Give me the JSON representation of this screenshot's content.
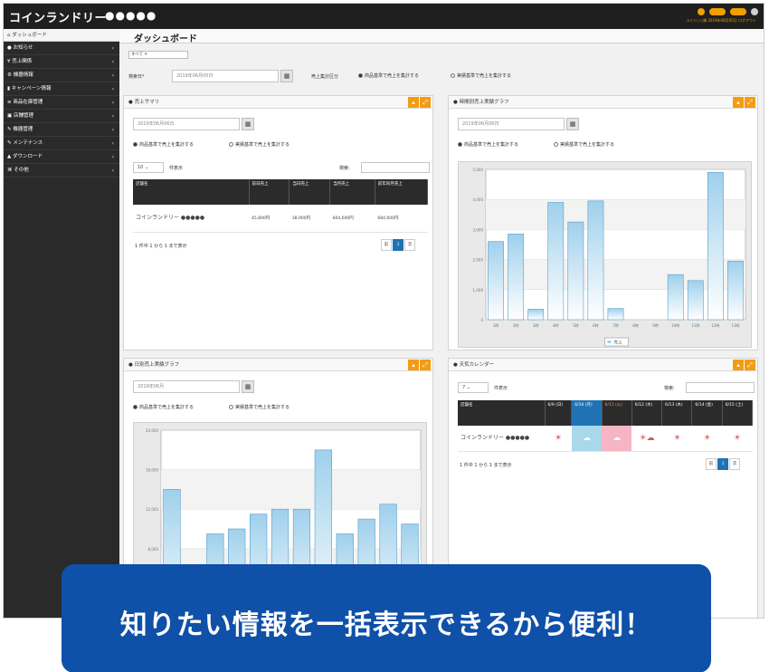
{
  "header": {
    "brand": "コインランドリー",
    "brand_dots": "●●●●●",
    "user_line": "コイン○○様 2019年06月05日 ログアウト"
  },
  "sidebar": {
    "active": "ダッシュボード",
    "items": [
      {
        "label": "お知らせ"
      },
      {
        "label": "売上関係"
      },
      {
        "label": "機器情報"
      },
      {
        "label": "キャンペーン情報"
      },
      {
        "label": "商品在庫管理"
      },
      {
        "label": "店舗管理"
      },
      {
        "label": "機器管理"
      },
      {
        "label": "メンテナンス"
      },
      {
        "label": "ダウンロード"
      },
      {
        "label": "その他"
      }
    ]
  },
  "page": {
    "title": "ダッシュボード",
    "tag": "すべて ✕",
    "date_label": "検索日",
    "date_value": "2019年06月05日",
    "period_label": "売上集計区分",
    "radio_1": "商品基準で売上を集計する",
    "radio_2": "実績基準で売上を集計する"
  },
  "panel_sales": {
    "title": "売上サマリ",
    "date": "2019年06月06日",
    "radio_1": "商品基準で売上を集計する",
    "radio_2": "実績基準で売上を集計する",
    "page_size": "10",
    "page_size_label": "件表示",
    "search_label": "検索:",
    "columns": [
      "店舗名",
      "前日売上",
      "当日売上",
      "当月売上",
      "前年同月売上"
    ],
    "rows": [
      {
        "name": "コインランドリー ●●●●●",
        "c1": "45,800円",
        "c2": "38,900円",
        "c3": "844,600円",
        "c4": "684,600円"
      }
    ],
    "info": "1 件中 1 から 1 まで表示",
    "pager": [
      "前",
      "1",
      "次"
    ]
  },
  "panel_hourly": {
    "title": "時間別売上実績グラフ",
    "date": "2019年06月06日",
    "radio_1": "商品基準で売上を集計する",
    "radio_2": "実績基準で売上を集計する",
    "legend": "売上"
  },
  "panel_daily": {
    "title": "日別売上実績グラフ",
    "date": "2019年06月",
    "radio_1": "商品基準で売上を集計する",
    "radio_2": "実績基準で売上を集計する"
  },
  "panel_weather": {
    "title": "天気カレンダー",
    "page_size": "7",
    "page_size_label": "件表示",
    "search_label": "検索:",
    "columns": [
      "店舗名",
      "6/9 (日)",
      "6/10 (月)",
      "6/11 (火)",
      "6/12 (水)",
      "6/13 (木)",
      "6/14 (金)",
      "6/15 (土)"
    ],
    "row_name": "コインランドリー ●●●●●",
    "cells": [
      "☀",
      "☁",
      "☁",
      "☀☁",
      "☀",
      "☀",
      "☀"
    ],
    "info": "1 件中 1 から 1 まで表示",
    "pager": [
      "前",
      "1",
      "次"
    ]
  },
  "banner": {
    "text": "知りたい情報を一括表示できるから便利！"
  },
  "colors": {
    "sidebar": "#2a2a2a",
    "accent": "#f39c12",
    "bar_top": "#9fd0ec",
    "bar_bottom": "#ffffff",
    "banner": "#0f50a8",
    "sunday": "#1f73b5",
    "holiday": "#d9534f"
  },
  "chart_data": [
    {
      "type": "bar",
      "title": "時間別売上実績グラフ",
      "categories": [
        "1",
        "2",
        "3",
        "4",
        "5",
        "6",
        "7",
        "8",
        "9",
        "10",
        "11",
        "12",
        "13",
        "14",
        "15",
        "16",
        "17",
        "18"
      ],
      "series": [
        {
          "name": "売上",
          "values": [
            2600,
            2850,
            350,
            3900,
            3250,
            3950,
            370,
            0,
            0,
            1500,
            1300,
            4900,
            1950
          ]
        }
      ],
      "ylim": [
        0,
        5000
      ]
    },
    {
      "type": "bar",
      "title": "日別売上実績グラフ",
      "series": [
        {
          "name": "",
          "values": [
            14000,
            3000,
            9500,
            10000,
            11500,
            12000,
            12000,
            18000,
            9500,
            11000,
            12500,
            10500
          ]
        }
      ],
      "ylim": [
        0,
        20000
      ]
    }
  ]
}
